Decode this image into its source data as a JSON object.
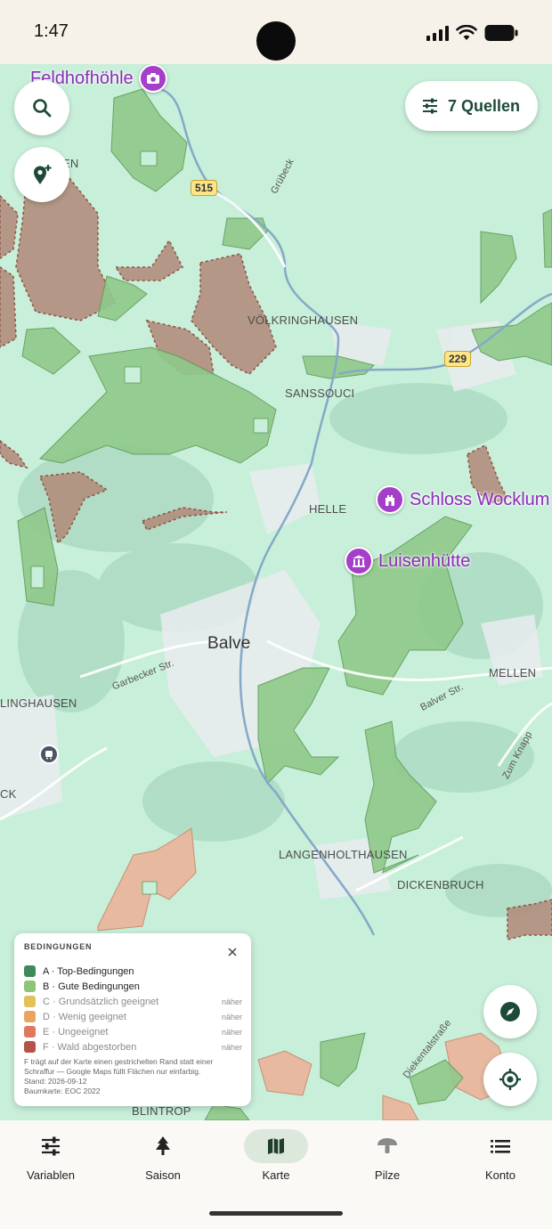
{
  "status_bar": {
    "time": "1:47"
  },
  "map": {
    "sources_button_label": "7 Quellen",
    "pois": [
      {
        "label": "Feldhofhöhle",
        "icon": "camera-icon"
      },
      {
        "label": "Schloss Wocklum",
        "icon": "castle-icon"
      },
      {
        "label": "Luisenhütte",
        "icon": "museum-icon"
      }
    ],
    "places": {
      "volkringhausen": "VÖLKRINGHAUSEN",
      "sanssouci": "SANSSOUCI",
      "helle": "HELLE",
      "balve": "Balve",
      "mellen": "MELLEN",
      "linghausen": "LINGHAUSEN",
      "langenholthausen": "LANGENHOLTHAUSEN",
      "dickenbruch": "DICKENBRUCH",
      "blintrop": "BLINTROP",
      "en": "EN",
      "ck": "CK"
    },
    "streets": {
      "grubeck": "Grübeck",
      "garbecker": "Garbecker Str.",
      "balver": "Balver Str.",
      "zum_knapp": "Zum Knapp",
      "dieken": "Diekentalstraße"
    },
    "road_numbers": {
      "b515": "515",
      "b229": "229"
    }
  },
  "legend": {
    "title": "BEDINGUNGEN",
    "rows": [
      {
        "label": "A · Top-Bedingungen",
        "color": "#3d8b5a",
        "more": ""
      },
      {
        "label": "B · Gute Bedingungen",
        "color": "#8cc47a",
        "more": ""
      },
      {
        "label": "C · Grundsätzlich geeignet",
        "color": "#e2c258",
        "more": "näher"
      },
      {
        "label": "D · Wenig geeignet",
        "color": "#e9a45e",
        "more": "näher"
      },
      {
        "label": "E · Ungeeignet",
        "color": "#e0785e",
        "more": "näher"
      },
      {
        "label": "F · Wald abgestorben",
        "color": "#b5534a",
        "more": "näher"
      }
    ],
    "note": "F trägt auf der Karte einen gestrichelten Rand statt einer Schraffur — Google Maps füllt Flächen nur einfarbig.",
    "stand": "Stand: 2026-09-12",
    "baumkarte": "Baumkarte: EOC 2022"
  },
  "nav": {
    "items": [
      {
        "label": "Variablen",
        "icon": "sliders-icon"
      },
      {
        "label": "Saison",
        "icon": "tree-icon"
      },
      {
        "label": "Karte",
        "icon": "map-icon",
        "active": true
      },
      {
        "label": "Pilze",
        "icon": "mushroom-icon"
      },
      {
        "label": "Konto",
        "icon": "list-icon"
      }
    ]
  },
  "colors": {
    "map_base": "#c8efd9",
    "forest_good": "#8cc47a",
    "dead_forest": "#b08c7d",
    "poi": "#a53fc9",
    "accent": "#1d4a37"
  }
}
